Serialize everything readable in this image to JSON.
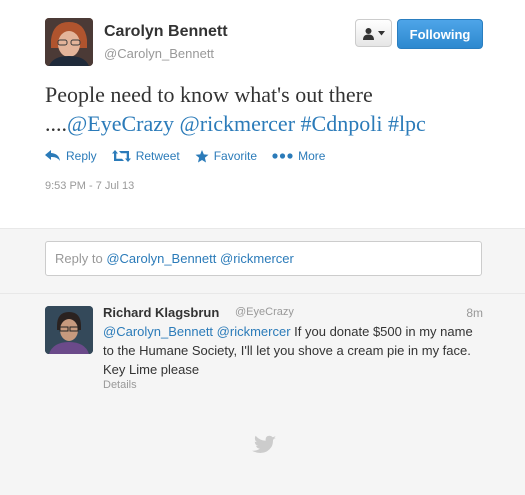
{
  "main_tweet": {
    "author_name": "Carolyn Bennett",
    "author_handle": "@Carolyn_Bennett",
    "user_menu_icon": "person-dropdown-icon",
    "follow_label": "Following",
    "text_plain": "People need to know what's out there ....",
    "text_mention_1": "@EyeCrazy",
    "text_mention_2": "@rickmercer",
    "text_hashtag_1": "#Cdnpoli",
    "text_hashtag_2": "#lpc",
    "actions": {
      "reply": "Reply",
      "retweet": "Retweet",
      "favorite": "Favorite",
      "more": "More"
    },
    "timestamp": "9:53 PM - 7 Jul 13"
  },
  "reply_box": {
    "prefix": "Reply to",
    "mention_1": "@Carolyn_Bennett",
    "mention_2": "@rickmercer"
  },
  "reply_tweet": {
    "author_name": "Richard Klagsbrun",
    "author_handle": "@EyeCrazy",
    "time": "8m",
    "mention_1": "@Carolyn_Bennett",
    "mention_2": "@rickmercer",
    "text": "If you donate $500 in my name to the Humane Society, I'll let you shove a cream pie in my face. Key Lime please",
    "details_label": "Details"
  },
  "colors": {
    "link": "#2b7bb9",
    "follow_button": "#2d89cf",
    "muted_text": "#999999",
    "background_alt": "#f5f5f5"
  }
}
